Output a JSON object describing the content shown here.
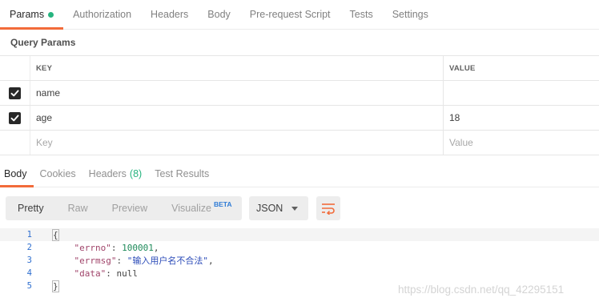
{
  "request_tabs": [
    {
      "label": "Params",
      "active": true,
      "dot_color": "#26b47f"
    },
    {
      "label": "Authorization"
    },
    {
      "label": "Headers"
    },
    {
      "label": "Body"
    },
    {
      "label": "Pre-request Script"
    },
    {
      "label": "Tests"
    },
    {
      "label": "Settings"
    }
  ],
  "query_params": {
    "title": "Query Params",
    "columns": {
      "key": "KEY",
      "value": "VALUE"
    },
    "rows": [
      {
        "checked": true,
        "key": "name",
        "value": ""
      },
      {
        "checked": true,
        "key": "age",
        "value": "18"
      }
    ],
    "placeholder": {
      "key": "Key",
      "value": "Value"
    }
  },
  "response_tabs": [
    {
      "label": "Body",
      "active": true
    },
    {
      "label": "Cookies"
    },
    {
      "label": "Headers",
      "count": "(8)"
    },
    {
      "label": "Test Results"
    }
  ],
  "toolbar": {
    "view_modes": [
      "Pretty",
      "Raw",
      "Preview",
      "Visualize"
    ],
    "active_mode": "Pretty",
    "beta_badge": "BETA",
    "format": "JSON",
    "wrap_icon": "wrap-lines-icon"
  },
  "response_body": {
    "lines": [
      "1",
      "2",
      "3",
      "4",
      "5"
    ],
    "open_brace": "{",
    "close_brace": "}",
    "fields": [
      {
        "key": "\"errno\"",
        "value": "100001",
        "type": "number"
      },
      {
        "key": "\"errmsg\"",
        "value": "\"输入用户名不合法\"",
        "type": "string"
      },
      {
        "key": "\"data\"",
        "value": "null",
        "type": "null"
      }
    ]
  },
  "watermark": "https://blog.csdn.net/qq_42295151",
  "colors": {
    "accent": "#f26b3a",
    "success": "#26b47f",
    "line_number": "#2f6fcf",
    "beta": "#2f7cd6"
  }
}
